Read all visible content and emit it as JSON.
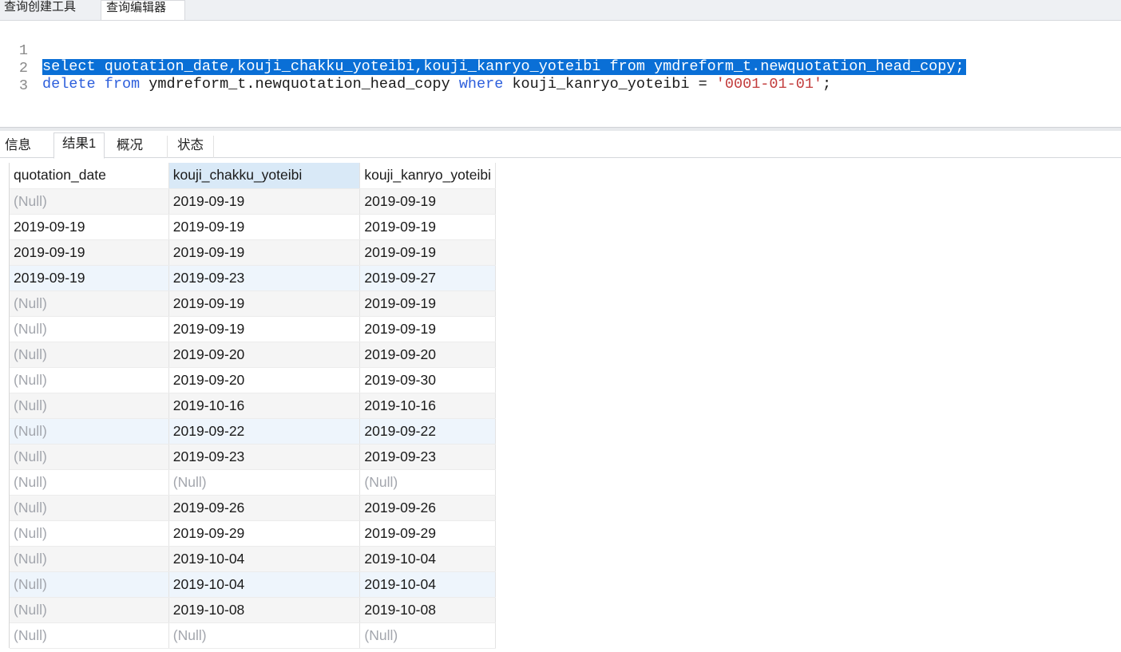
{
  "top_tabs": [
    "查询创建工具",
    "查询编辑器"
  ],
  "editor": {
    "line_numbers": [
      "1",
      "2",
      "3"
    ],
    "line1": "select quotation_date,kouji_chakku_yoteibi,kouji_kanryo_yoteibi from ymdreform_t.newquotation_head_copy;",
    "line2": {
      "kw1": "delete",
      "t1": " ",
      "kw2": "from",
      "t2": " ymdreform_t.newquotation_head_copy ",
      "kw3": "where",
      "t3": " kouji_kanryo_yoteibi = ",
      "str": "'0001-01-01'",
      "t4": ";"
    },
    "line3": ""
  },
  "result_tabs": [
    "信息",
    "结果1",
    "概况",
    "状态"
  ],
  "grid": {
    "columns": [
      "quotation_date",
      "kouji_chakku_yoteibi",
      "kouji_kanryo_yoteibi"
    ],
    "rows": [
      [
        "(Null)",
        "2019-09-19",
        "2019-09-19"
      ],
      [
        "2019-09-19",
        "2019-09-19",
        "2019-09-19"
      ],
      [
        "2019-09-19",
        "2019-09-19",
        "2019-09-19"
      ],
      [
        "2019-09-19",
        "2019-09-23",
        "2019-09-27"
      ],
      [
        "(Null)",
        "2019-09-19",
        "2019-09-19"
      ],
      [
        "(Null)",
        "2019-09-19",
        "2019-09-19"
      ],
      [
        "(Null)",
        "2019-09-20",
        "2019-09-20"
      ],
      [
        "(Null)",
        "2019-09-20",
        "2019-09-30"
      ],
      [
        "(Null)",
        "2019-10-16",
        "2019-10-16"
      ],
      [
        "(Null)",
        "2019-09-22",
        "2019-09-22"
      ],
      [
        "(Null)",
        "2019-09-23",
        "2019-09-23"
      ],
      [
        "(Null)",
        "(Null)",
        "(Null)"
      ],
      [
        "(Null)",
        "2019-09-26",
        "2019-09-26"
      ],
      [
        "(Null)",
        "2019-09-29",
        "2019-09-29"
      ],
      [
        "(Null)",
        "2019-10-04",
        "2019-10-04"
      ],
      [
        "(Null)",
        "2019-10-04",
        "2019-10-04"
      ],
      [
        "(Null)",
        "2019-10-08",
        "2019-10-08"
      ],
      [
        "(Null)",
        "(Null)",
        "(Null)"
      ]
    ]
  }
}
